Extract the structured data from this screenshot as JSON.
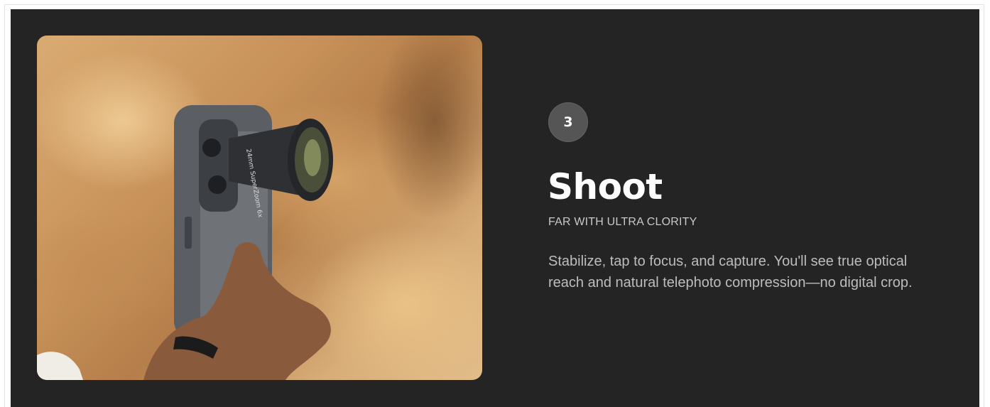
{
  "step": {
    "number": "3",
    "title": "Shoot",
    "subtitle": "FAR WITH ULTRA CLORITY",
    "description": "Stabilize, tap to focus, and capture. You'll see true optical reach and natural telephoto compression—no digital crop."
  },
  "photo": {
    "lens_text": "24mm SuperZoom 6x",
    "icon": "phone-with-telephoto-lens"
  },
  "colors": {
    "panel_background": "#242424",
    "badge_background": "#555555",
    "title": "#ffffff",
    "body_text": "#bdbdbd"
  }
}
